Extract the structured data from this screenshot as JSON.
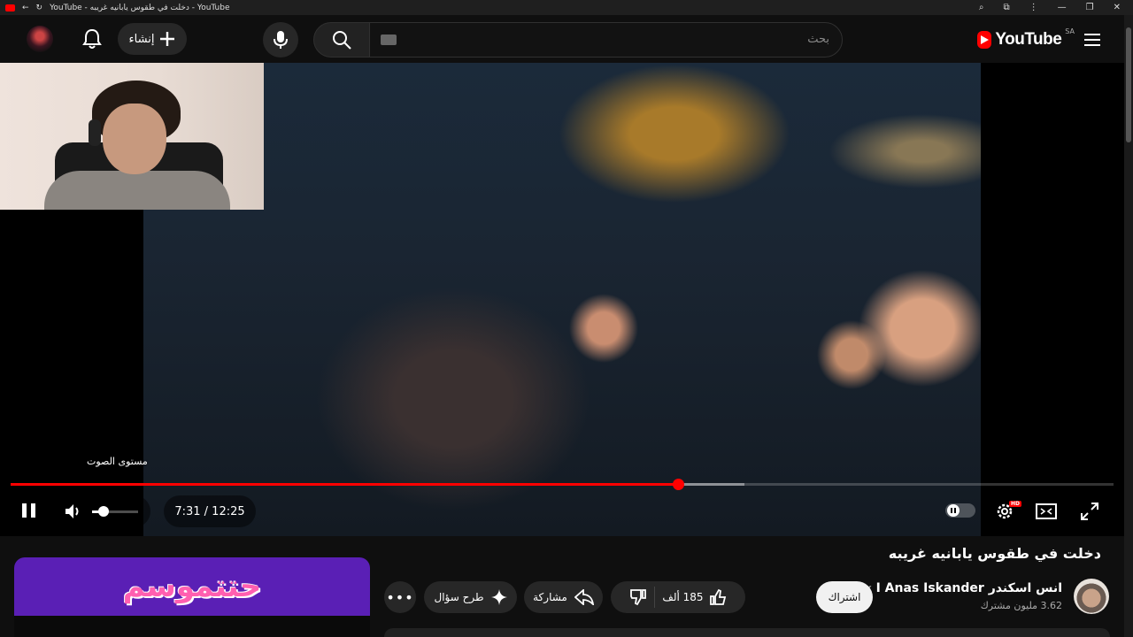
{
  "browser": {
    "tab_title": "YouTube - دخلت في طقوس يابانيه غريبه - YouTube"
  },
  "masthead": {
    "create_label": "إنشاء",
    "search_placeholder": "بحث",
    "logo_text": "YouTube",
    "country_code": "SA"
  },
  "player": {
    "volume_tooltip": "مستوى الصوت",
    "current_time": "7:31",
    "duration": "12:25",
    "time_display": "7:31 / 12:25",
    "progress_fraction": 0.605,
    "buffered_fraction": 0.665,
    "volume_fraction": 0.25,
    "hd_badge": "HD"
  },
  "video": {
    "title": "دخلت في طقوس يابانيه غريبه",
    "channel_name": "انس اسكندر I Anas Iskander",
    "subscribers": "3.62 مليون مشترك",
    "subscribe_label": "اشتراك",
    "like_count": "185 ألف",
    "share_label": "مشاركة",
    "ask_label": "طرح سؤال"
  },
  "ad": {
    "banner_text": "حتتموسم"
  },
  "colors": {
    "accent": "#ff0000",
    "background": "#0f0f0f"
  }
}
